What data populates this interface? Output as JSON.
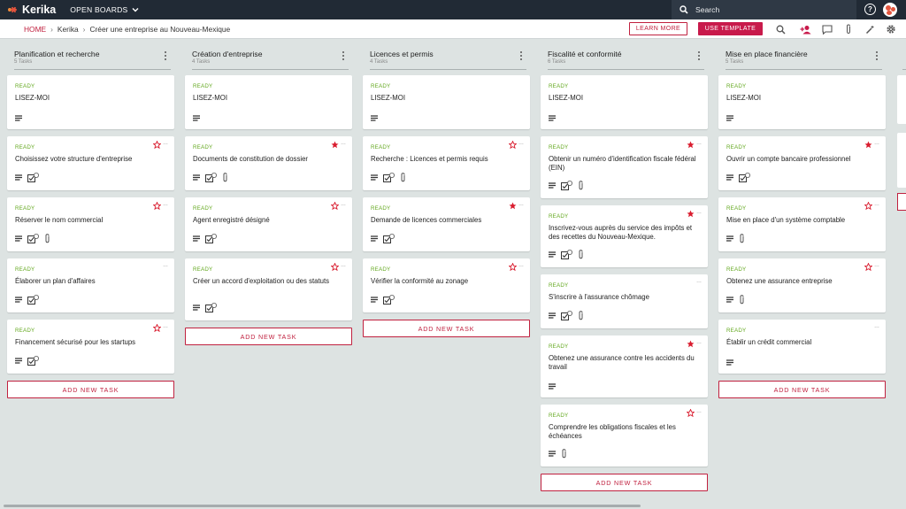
{
  "app": {
    "name": "Kerika",
    "open_boards": "OPEN BOARDS",
    "search_placeholder": "Search"
  },
  "breadcrumb": {
    "home": "HOME",
    "org": "Kerika",
    "board": "Créer une entreprise au Nouveau-Mexique"
  },
  "actions": {
    "learn_more": "LEARN MORE",
    "use_template": "USE TEMPLATE"
  },
  "toolbar_icons": [
    "search-icon",
    "add-person-icon",
    "chat-icon",
    "attachment-icon",
    "wand-icon",
    "gear-icon"
  ],
  "colors": {
    "accent": "#c81a4b",
    "ready": "#63a81f",
    "topbar": "#212a35",
    "board_bg": "#dde3e2",
    "star": "#d91c2e"
  },
  "add_task_label": "ADD NEW TASK",
  "columns": [
    {
      "title": "Planification et recherche",
      "count": "5 Tasks",
      "cards": [
        {
          "status": "READY",
          "title": "LISEZ-MOI",
          "star": "none",
          "checklist": false,
          "attach": false
        },
        {
          "status": "READY",
          "title": "Choisissez votre structure d'entreprise",
          "star": "outline",
          "checklist": true,
          "attach": false
        },
        {
          "status": "READY",
          "title": "Réserver le nom commercial",
          "star": "outline",
          "checklist": true,
          "attach": true
        },
        {
          "status": "READY",
          "title": "Élaborer un plan d'affaires",
          "star": "none",
          "checklist": true,
          "attach": false
        },
        {
          "status": "READY",
          "title": "Financement sécurisé pour les startups",
          "star": "outline",
          "checklist": true,
          "attach": false
        }
      ]
    },
    {
      "title": "Création d'entreprise",
      "count": "4 Tasks",
      "cards": [
        {
          "status": "READY",
          "title": "LISEZ-MOI",
          "star": "none",
          "checklist": false,
          "attach": false
        },
        {
          "status": "READY",
          "title": "Documents de constitution de dossier",
          "star": "filled",
          "checklist": true,
          "attach": true
        },
        {
          "status": "READY",
          "title": "Agent enregistré désigné",
          "star": "outline",
          "checklist": true,
          "attach": false
        },
        {
          "status": "READY",
          "title": "Créer un accord d'exploitation ou des statuts",
          "star": "outline",
          "checklist": true,
          "attach": false
        }
      ]
    },
    {
      "title": "Licences et permis",
      "count": "4 Tasks",
      "cards": [
        {
          "status": "READY",
          "title": "LISEZ-MOI",
          "star": "none",
          "checklist": false,
          "attach": false
        },
        {
          "status": "READY",
          "title": "Recherche : Licences et permis requis",
          "star": "outline",
          "checklist": true,
          "attach": true
        },
        {
          "status": "READY",
          "title": "Demande de licences commerciales",
          "star": "filled",
          "checklist": true,
          "attach": false
        },
        {
          "status": "READY",
          "title": "Vérifier la conformité au zonage",
          "star": "outline",
          "checklist": true,
          "attach": false
        }
      ]
    },
    {
      "title": "Fiscalité et conformité",
      "count": "6 Tasks",
      "cards": [
        {
          "status": "READY",
          "title": "LISEZ-MOI",
          "star": "none",
          "checklist": false,
          "attach": false
        },
        {
          "status": "READY",
          "title": "Obtenir un numéro d'identification fiscale fédéral (EIN)",
          "star": "filled",
          "checklist": true,
          "attach": true
        },
        {
          "status": "READY",
          "title": "Inscrivez-vous auprès du service des impôts et des recettes du Nouveau-Mexique.",
          "star": "filled",
          "checklist": true,
          "attach": true
        },
        {
          "status": "READY",
          "title": "S'inscrire à l'assurance chômage",
          "star": "none",
          "checklist": true,
          "attach": true
        },
        {
          "status": "READY",
          "title": "Obtenez une assurance contre les accidents du travail",
          "star": "filled",
          "checklist": false,
          "attach": false
        },
        {
          "status": "READY",
          "title": "Comprendre les obligations fiscales et les échéances",
          "star": "outline",
          "checklist": false,
          "attach": true
        }
      ]
    },
    {
      "title": "Mise en place financière",
      "count": "5 Tasks",
      "cards": [
        {
          "status": "READY",
          "title": "LISEZ-MOI",
          "star": "none",
          "checklist": false,
          "attach": false
        },
        {
          "status": "READY",
          "title": "Ouvrir un compte bancaire professionnel",
          "star": "filled",
          "checklist": true,
          "attach": false
        },
        {
          "status": "READY",
          "title": "Mise en place d'un système comptable",
          "star": "outline",
          "checklist": false,
          "attach": true
        },
        {
          "status": "READY",
          "title": "Obtenez une assurance entreprise",
          "star": "outline",
          "checklist": false,
          "attach": true
        },
        {
          "status": "READY",
          "title": "Établir un crédit commercial",
          "star": "none",
          "checklist": false,
          "attach": false
        }
      ]
    }
  ]
}
